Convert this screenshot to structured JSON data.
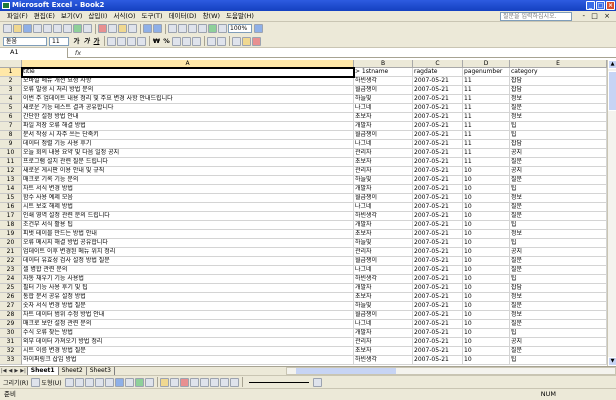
{
  "window": {
    "title": "Microsoft Excel - Book2"
  },
  "menu": {
    "items": [
      "파일(F)",
      "편집(E)",
      "보기(V)",
      "삽입(I)",
      "서식(O)",
      "도구(T)",
      "데이터(D)",
      "창(W)",
      "도움말(H)"
    ],
    "help_placeholder": "질문을 입력하십시오."
  },
  "toolbar": {
    "zoom": "100%"
  },
  "format_toolbar": {
    "font": "돋움",
    "size": "11",
    "bold": "가",
    "italic": "가",
    "underline": "가",
    "currency": "₩",
    "percent": "%"
  },
  "formula_bar": {
    "cell_ref": "A1",
    "fx": "fx"
  },
  "columns": [
    {
      "label": "A",
      "selected": true
    },
    {
      "label": "B",
      "selected": false
    },
    {
      "label": "C",
      "selected": false
    },
    {
      "label": "D",
      "selected": false
    },
    {
      "label": "E",
      "selected": false
    }
  ],
  "rows": [
    {
      "n": "1",
      "a": "title",
      "b": "> 1stname",
      "c": "ragdate",
      "d": "pagenumber",
      "e": "category",
      "sel": true
    },
    {
      "n": "2",
      "a": "모바일 메뉴 개선 요청 사항",
      "b": "하빈생각",
      "c": "2007-05-21",
      "d": "11",
      "e": "잡담"
    },
    {
      "n": "3",
      "a": "오류 발생 시 처리 방법 문의",
      "b": "월급쟁이",
      "c": "2007-05-21",
      "d": "11",
      "e": "잡담"
    },
    {
      "n": "4",
      "a": "이번 주 업데이트 내용 정리 및 주요 변경 사항 안내드립니다",
      "b": "하늘빛",
      "c": "2007-05-21",
      "d": "11",
      "e": "정보"
    },
    {
      "n": "5",
      "a": "새로운 기능 테스트 결과 공유합니다",
      "b": "나그네",
      "c": "2007-05-21",
      "d": "11",
      "e": "질문"
    },
    {
      "n": "6",
      "a": "간단한 설정 방법 안내",
      "b": "초보자",
      "c": "2007-05-21",
      "d": "11",
      "e": "정보"
    },
    {
      "n": "7",
      "a": "파일 저장 오류 해결 방법",
      "b": "개발자",
      "c": "2007-05-21",
      "d": "11",
      "e": "팁"
    },
    {
      "n": "8",
      "a": "문서 작성 시 자주 쓰는 단축키",
      "b": "월급쟁이",
      "c": "2007-05-21",
      "d": "11",
      "e": "팁"
    },
    {
      "n": "9",
      "a": "데이터 정렬 기능 사용 후기",
      "b": "나그네",
      "c": "2007-05-21",
      "d": "11",
      "e": "잡담"
    },
    {
      "n": "10",
      "a": "오늘 회의 내용 요약 및 다음 일정 공지",
      "b": "관리자",
      "c": "2007-05-21",
      "d": "11",
      "e": "공지"
    },
    {
      "n": "11",
      "a": "프로그램 설치 관련 질문 드립니다",
      "b": "초보자",
      "c": "2007-05-21",
      "d": "11",
      "e": "질문"
    },
    {
      "n": "12",
      "a": "새로운 게시판 이용 안내 및 규칙",
      "b": "관리자",
      "c": "2007-05-21",
      "d": "10",
      "e": "공지"
    },
    {
      "n": "13",
      "a": "매크로 기록 기능 문의",
      "b": "하늘빛",
      "c": "2007-05-21",
      "d": "10",
      "e": "질문"
    },
    {
      "n": "14",
      "a": "차트 서식 변경 방법",
      "b": "개발자",
      "c": "2007-05-21",
      "d": "10",
      "e": "팁"
    },
    {
      "n": "15",
      "a": "함수 사용 예제 모음",
      "b": "월급쟁이",
      "c": "2007-05-21",
      "d": "10",
      "e": "정보"
    },
    {
      "n": "16",
      "a": "시트 보호 해제 방법",
      "b": "나그네",
      "c": "2007-05-21",
      "d": "10",
      "e": "질문"
    },
    {
      "n": "17",
      "a": "인쇄 영역 설정 관련 문의 드립니다",
      "b": "하빈생각",
      "c": "2007-05-21",
      "d": "10",
      "e": "질문"
    },
    {
      "n": "18",
      "a": "조건부 서식 활용 팁",
      "b": "개발자",
      "c": "2007-05-21",
      "d": "10",
      "e": "팁"
    },
    {
      "n": "19",
      "a": "피벗 테이블 만드는 방법 안내",
      "b": "초보자",
      "c": "2007-05-21",
      "d": "10",
      "e": "정보"
    },
    {
      "n": "20",
      "a": "오류 메시지 해결 방법 공유합니다",
      "b": "하늘빛",
      "c": "2007-05-21",
      "d": "10",
      "e": "팁"
    },
    {
      "n": "21",
      "a": "업데이트 이후 변경된 메뉴 위치 정리",
      "b": "관리자",
      "c": "2007-05-21",
      "d": "10",
      "e": "공지"
    },
    {
      "n": "22",
      "a": "데이터 유효성 검사 설정 방법 질문",
      "b": "월급쟁이",
      "c": "2007-05-21",
      "d": "10",
      "e": "질문"
    },
    {
      "n": "23",
      "a": "셀 병합 관련 문의",
      "b": "나그네",
      "c": "2007-05-21",
      "d": "10",
      "e": "질문"
    },
    {
      "n": "24",
      "a": "자동 채우기 기능 사용법",
      "b": "하빈생각",
      "c": "2007-05-21",
      "d": "10",
      "e": "팁"
    },
    {
      "n": "25",
      "a": "필터 기능 사용 후기 및 팁",
      "b": "개발자",
      "c": "2007-05-21",
      "d": "10",
      "e": "잡담"
    },
    {
      "n": "26",
      "a": "통합 문서 공유 설정 방법",
      "b": "초보자",
      "c": "2007-05-21",
      "d": "10",
      "e": "정보"
    },
    {
      "n": "27",
      "a": "숫자 서식 변경 방법 질문",
      "b": "하늘빛",
      "c": "2007-05-21",
      "d": "10",
      "e": "질문"
    },
    {
      "n": "28",
      "a": "차트 데이터 범위 수정 방법 안내",
      "b": "월급쟁이",
      "c": "2007-05-21",
      "d": "10",
      "e": "정보"
    },
    {
      "n": "29",
      "a": "매크로 보안 설정 관련 문의",
      "b": "나그네",
      "c": "2007-05-21",
      "d": "10",
      "e": "질문"
    },
    {
      "n": "30",
      "a": "수식 오류 찾는 방법",
      "b": "개발자",
      "c": "2007-05-21",
      "d": "10",
      "e": "팁"
    },
    {
      "n": "31",
      "a": "외부 데이터 가져오기 방법 정리",
      "b": "관리자",
      "c": "2007-05-21",
      "d": "10",
      "e": "공지"
    },
    {
      "n": "32",
      "a": "시트 이름 변경 방법 질문",
      "b": "초보자",
      "c": "2007-05-21",
      "d": "10",
      "e": "질문"
    },
    {
      "n": "33",
      "a": "하이퍼링크 삽입 방법",
      "b": "하빈생각",
      "c": "2007-05-21",
      "d": "10",
      "e": "팁"
    }
  ],
  "sheets": [
    {
      "label": "Sheet1",
      "active": true
    },
    {
      "label": "Sheet2",
      "active": false
    },
    {
      "label": "Sheet3",
      "active": false
    }
  ],
  "drawing": {
    "draw_label": "그리기(R)",
    "autoshape_label": "도형(U)"
  },
  "status": {
    "left": "준비",
    "num": "NUM"
  }
}
